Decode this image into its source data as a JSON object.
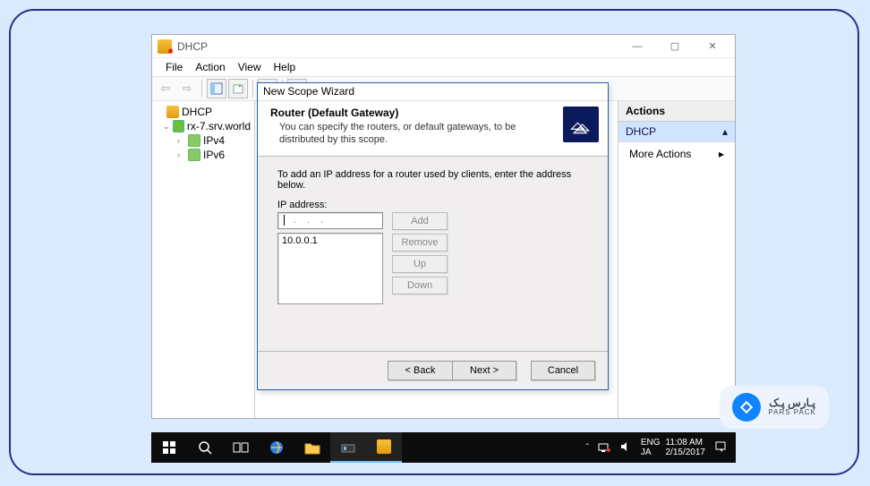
{
  "window": {
    "title": "DHCP",
    "btn_min": "—",
    "btn_max": "▢",
    "btn_close": "✕"
  },
  "menu": {
    "file": "File",
    "action": "Action",
    "view": "View",
    "help": "Help"
  },
  "tree": {
    "root": "DHCP",
    "server": "rx-7.srv.world",
    "ipv4": "IPv4",
    "ipv6": "IPv6"
  },
  "actions": {
    "header": "Actions",
    "selected": "DHCP",
    "more": "More Actions",
    "arrow_up": "▴",
    "arrow_right": "▸"
  },
  "wizard": {
    "title": "New Scope Wizard",
    "heading": "Router (Default Gateway)",
    "subheading": "You can specify the routers, or default gateways, to be distributed by this scope.",
    "instruction": "To add an IP address for a router used by clients, enter the address below.",
    "ip_label": "IP address:",
    "list_entry": "10.0.0.1",
    "btn_add": "Add",
    "btn_remove": "Remove",
    "btn_up": "Up",
    "btn_down": "Down",
    "btn_back": "< Back",
    "btn_next": "Next >",
    "btn_cancel": "Cancel"
  },
  "taskbar": {
    "lang1": "ENG",
    "lang2": "JA",
    "time": "11:08 AM",
    "date": "2/15/2017"
  },
  "badge": {
    "brand_fa": "پـارس پـک",
    "brand_en": "PARS PACK"
  }
}
